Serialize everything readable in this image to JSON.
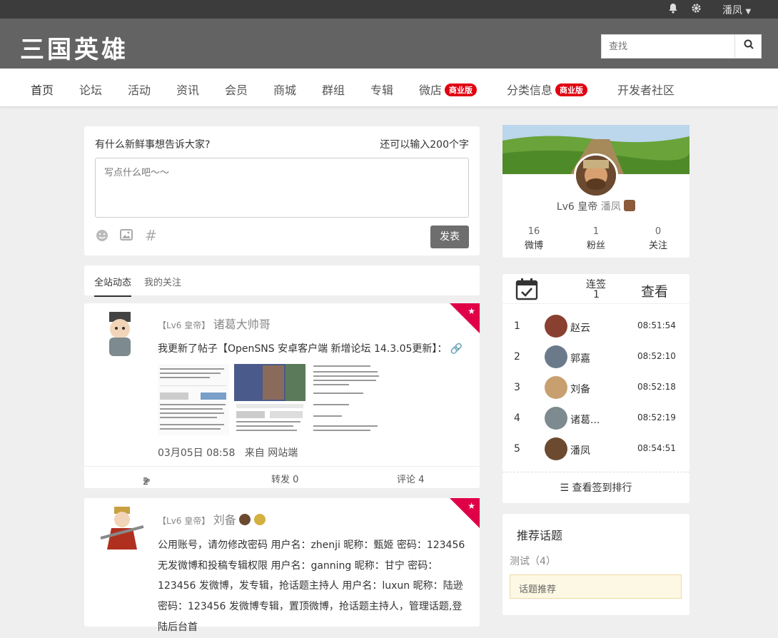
{
  "topbar": {
    "bell_icon": "bell-icon",
    "gear_icon": "gear-icon",
    "username": "潘凤"
  },
  "header": {
    "logo": "三国英雄",
    "search_placeholder": "查找"
  },
  "nav": {
    "items": [
      {
        "label": "首页"
      },
      {
        "label": "论坛"
      },
      {
        "label": "活动"
      },
      {
        "label": "资讯"
      },
      {
        "label": "会员"
      },
      {
        "label": "商城"
      },
      {
        "label": "群组"
      },
      {
        "label": "专辑"
      },
      {
        "label": "微店",
        "badge": "商业版"
      },
      {
        "label": "分类信息",
        "badge": "商业版"
      },
      {
        "label": "开发者社区"
      }
    ]
  },
  "composer": {
    "prompt": "有什么新鲜事想告诉大家?",
    "remaining": "还可以输入200个字",
    "placeholder": "写点什么吧～～",
    "send": "发表"
  },
  "tabs": {
    "all": "全站动态",
    "following": "我的关注"
  },
  "feed": [
    {
      "level": "【Lv6 皇帝】",
      "name": "诸葛大帅哥",
      "content": "我更新了帖子【OpenSNS 安卓客户端 新增论坛 14.3.05更新】：",
      "time": "03月05日 08:58",
      "source": "来自 网站端",
      "likes": "2",
      "repost": "转发 0",
      "comment": "评论 4"
    },
    {
      "level": "【Lv6 皇帝】",
      "name": "刘备",
      "content": "公用账号，请勿修改密码 用户名：zhenji 昵称：甄姬 密码：123456 无发微博和投稿专辑权限 用户名：ganning 昵称：甘宁 密码：123456 发微博，发专辑，抢话题主持人 用户名：luxun 昵称：陆逊 密码：123456 发微博专辑，置顶微博，抢话题主持人，管理话题,登陆后台首"
    }
  ],
  "profile": {
    "level": "Lv6 皇帝",
    "name": "潘凤",
    "stats": [
      {
        "v": "16",
        "l": "微博"
      },
      {
        "v": "1",
        "l": "粉丝"
      },
      {
        "v": "0",
        "l": "关注"
      }
    ]
  },
  "checkin": {
    "streak_label": "连签",
    "streak_value": "1",
    "view": "查看",
    "rank_link": "查看签到排行",
    "ranks": [
      {
        "n": "1",
        "name": "赵云",
        "time": "08:51:54"
      },
      {
        "n": "2",
        "name": "郭嘉",
        "time": "08:52:10"
      },
      {
        "n": "3",
        "name": "刘备",
        "time": "08:52:18"
      },
      {
        "n": "4",
        "name": "诸葛...",
        "time": "08:52:19"
      },
      {
        "n": "5",
        "name": "潘凤",
        "time": "08:54:51"
      }
    ]
  },
  "topics": {
    "title": "推荐话题",
    "tag": "测试（4）",
    "recommend": "话题推荐"
  }
}
